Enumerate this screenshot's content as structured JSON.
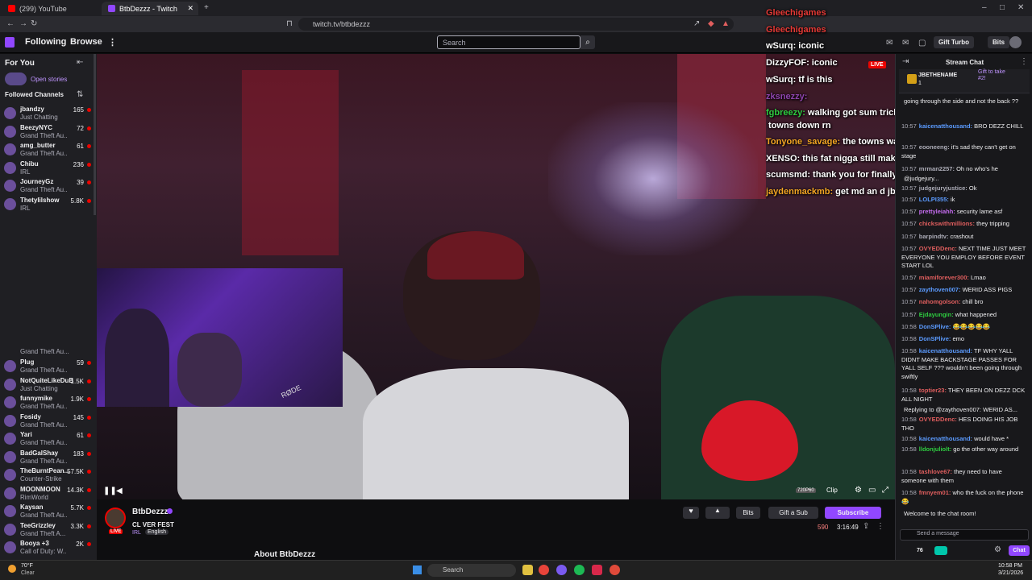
{
  "browser": {
    "tabs": [
      {
        "label": "(299) YouTube"
      },
      {
        "label": "BtbDezzz - Twitch"
      }
    ],
    "url": "twitch.tv/btbdezzz"
  },
  "topnav": {
    "following": "Following",
    "browse": "Browse",
    "more": "⋮",
    "search_placeholder": "Search",
    "gift_turbo": "Gift Turbo",
    "bits": "Bits"
  },
  "sidebar": {
    "for_you": "For You",
    "open_stories": "Open stories",
    "followed_channels": "Followed Channels",
    "channels_top": [
      {
        "name": "jbandzy",
        "game": "Just Chatting",
        "viewers": "165"
      },
      {
        "name": "BeezyNYC",
        "game": "Grand Theft Au...",
        "viewers": "72"
      },
      {
        "name": "amg_butter",
        "game": "Grand Theft Au...",
        "viewers": "61"
      },
      {
        "name": "Chibu",
        "game": "IRL",
        "viewers": "236"
      },
      {
        "name": "JourneyGz",
        "game": "Grand Theft Au...",
        "viewers": "39"
      },
      {
        "name": "Thetylilshow",
        "game": "IRL",
        "viewers": "5.8K"
      }
    ],
    "partial_game": "Grand Theft Au...",
    "channels_bottom": [
      {
        "name": "Plug",
        "game": "Grand Theft Au...",
        "viewers": "59"
      },
      {
        "name": "NotQuiteLikeDuB",
        "game": "Just Chatting",
        "viewers": "1.5K"
      },
      {
        "name": "funnymike",
        "game": "Grand Theft Au...",
        "viewers": "1.9K"
      },
      {
        "name": "Fosidy",
        "game": "Grand Theft Au...",
        "viewers": "145"
      },
      {
        "name": "Yari",
        "game": "Grand Theft Au...",
        "viewers": "61"
      },
      {
        "name": "BadGalShay",
        "game": "Grand Theft Au...",
        "viewers": "183"
      },
      {
        "name": "TheBurntPean...",
        "game": "Counter-Strike",
        "viewers": "57.5K"
      },
      {
        "name": "MOONMOON",
        "game": "RimWorld",
        "viewers": "14.3K"
      },
      {
        "name": "Kaysan",
        "game": "Grand Theft Au...",
        "viewers": "5.7K"
      },
      {
        "name": "TeeGrizzley",
        "game": "Grand Theft A...",
        "viewers": "3.3K"
      },
      {
        "name": "Booya +3",
        "game": "Call of Duty: W...",
        "viewers": "2K"
      }
    ]
  },
  "overlay_chat": [
    {
      "user": "Gleechigames",
      "msg": "",
      "color": "#e53935"
    },
    {
      "user": "Gleechigames",
      "msg": "",
      "color": "#e53935"
    },
    {
      "user": "wSurq:",
      "msg": "iconic",
      "color": "#ffffff"
    },
    {
      "user": "DizzyFOF:",
      "msg": "iconic",
      "color": "#ffffff"
    },
    {
      "user": "wSurq:",
      "msg": "tf is this",
      "color": "#ffffff"
    },
    {
      "user": "zksnezzy:",
      "msg": "",
      "color": "#8e44ad"
    },
    {
      "user": "fgbreezy:",
      "msg": "walking got sum tricks up his sleeve he the reason",
      "color": "#2ecc40"
    },
    {
      "user": "",
      "msg": "towns down rn",
      "color": "#ffffff"
    },
    {
      "user": "Tonyone_savage:",
      "msg": "the towns was just a money scheme",
      "color": "#f4a623"
    },
    {
      "user": "XENSO:",
      "msg": "this fat nigga still making ms of ts",
      "color": "#ffffff"
    },
    {
      "user": "scumsmd:",
      "msg": "thank you for finally saying it",
      "color": "#ffffff"
    },
    {
      "user": "jaydenmackmb:",
      "msg": "get md an d jb to troll on overtime",
      "color": "#f4a623"
    }
  ],
  "video": {
    "live_badge": "LIVE",
    "quality": "720P60",
    "clip": "Clip",
    "webcam_mic": "RØDE"
  },
  "channel_info": {
    "name": "BtbDezzz",
    "title": "CL VER FEST",
    "tags": [
      "IRL",
      "English"
    ],
    "live": "LIVE",
    "viewers": "590",
    "uptime": "3:16:49",
    "about": "About BtbDezzz",
    "bits": "Bits",
    "gift_sub": "Gift a Sub",
    "subscribe": "Subscribe"
  },
  "chat": {
    "header": "Stream Chat",
    "pinned_user": "JBETHENAME",
    "pinned_count": "1",
    "gift_text": "Gift to take",
    "gift_rank": "#2!",
    "lines": [
      {
        "time": "",
        "user": "",
        "msg": "going through the side and not the back ??",
        "color": "#efeff1"
      },
      {
        "time": "10:57",
        "user": "kaicenatthousand:",
        "msg": "BRO DEZZ CHILL",
        "color": "#5b9bff"
      },
      {
        "time": "10:57",
        "user": "eooneeng:",
        "msg": "it's sad they can't get on stage",
        "color": "#adadb8"
      },
      {
        "time": "10:57",
        "user": "mrman2257:",
        "msg": "Oh no who's he",
        "color": "#adadb8"
      },
      {
        "time": "",
        "user": "",
        "msg": "@judgejury...",
        "color": "#adadb8"
      },
      {
        "time": "10:57",
        "user": "judgejuryjustice:",
        "msg": "Ok",
        "color": "#adadb8"
      },
      {
        "time": "10:57",
        "user": "LOLPI355:",
        "msg": "ik",
        "color": "#5b9bff"
      },
      {
        "time": "10:57",
        "user": "prettyleiahh:",
        "msg": "security lame asf",
        "color": "#c56cf0"
      },
      {
        "time": "10:57",
        "user": "chickswithmillions:",
        "msg": "they tripping",
        "color": "#e05e5e"
      },
      {
        "time": "10:57",
        "user": "barpindtv:",
        "msg": "crashout",
        "color": "#adadb8"
      },
      {
        "time": "10:57",
        "user": "OVYEDDenc:",
        "msg": "NEXT TIME JUST MEET EVERYONE YOU EMPLOY BEFORE EVENT START LOL",
        "color": "#e05e5e"
      },
      {
        "time": "10:57",
        "user": "miamiforever300:",
        "msg": "Lmao",
        "color": "#e05e5e"
      },
      {
        "time": "10:57",
        "user": "zaythoven007:",
        "msg": "WERID ASS PIGS",
        "color": "#5b9bff"
      },
      {
        "time": "10:57",
        "user": "nahomgolson:",
        "msg": "chill bro",
        "color": "#e05e5e"
      },
      {
        "time": "10:57",
        "user": "Ejdayungin:",
        "msg": "what happened",
        "color": "#2ecc40"
      },
      {
        "time": "10:58",
        "user": "DonSPlive:",
        "msg": "😂😂😂😂😂",
        "color": "#5b9bff"
      },
      {
        "time": "10:58",
        "user": "DonSPlive:",
        "msg": "emo",
        "color": "#5b9bff"
      },
      {
        "time": "10:58",
        "user": "kaicenatthousand:",
        "msg": "TF WHY YALL DIDNT MAKE BACKSTAGE PASSES FOR YALL SELF ??? wouldn't been going through swiftly",
        "color": "#5b9bff"
      },
      {
        "time": "10:58",
        "user": "toptier23:",
        "msg": "THEY BEEN ON DEZZ DCK ALL NIGHT",
        "color": "#e05e5e"
      },
      {
        "time": "",
        "user": "",
        "msg": "Replying to @zaythoven007: WERID AS...",
        "color": "#adadb8"
      },
      {
        "time": "10:58",
        "user": "OVYEDDenc:",
        "msg": "HES DOING HIS JOB THO",
        "color": "#e05e5e"
      },
      {
        "time": "10:58",
        "user": "kaicenatthousand:",
        "msg": "would have *",
        "color": "#5b9bff"
      },
      {
        "time": "10:58",
        "user": "lldonjuliolt:",
        "msg": "go the other way around",
        "color": "#2ecc40"
      },
      {
        "time": "10:58",
        "user": "tashlove67:",
        "msg": "they need to have someone with them",
        "color": "#e05e5e"
      },
      {
        "time": "10:58",
        "user": "fmnyem01:",
        "msg": "who the fuck on the phone 😂",
        "color": "#e05e5e"
      },
      {
        "time": "",
        "user": "",
        "msg": "Welcome to the chat room!",
        "color": "#efeff1"
      }
    ],
    "input_placeholder": "Send a message",
    "points": "76",
    "chat_button": "Chat"
  },
  "taskbar": {
    "temp": "70°F",
    "weather": "Clear",
    "search": "Search",
    "time": "10:58 PM",
    "date": "3/21/2026"
  },
  "colors": {
    "twitch_purple": "#9147ff",
    "live_red": "#eb0400"
  }
}
